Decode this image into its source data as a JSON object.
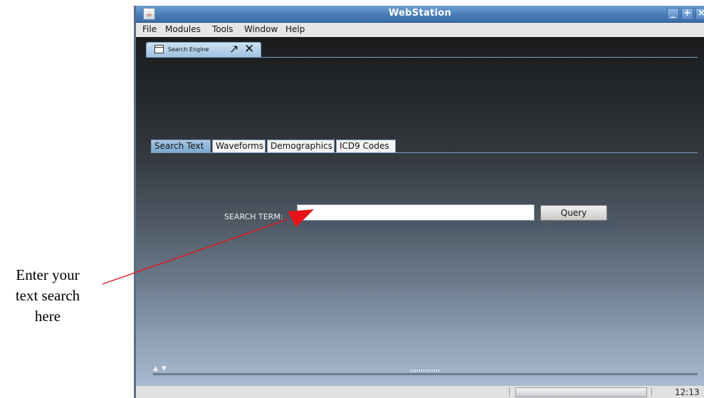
{
  "annotation": {
    "lines": [
      "Enter your",
      "text search",
      "here"
    ],
    "arrow_color": "#e8141a"
  },
  "window": {
    "title": "WebStation",
    "app_icon": "java-cup-icon",
    "buttons": {
      "minimize": "_",
      "maximize": "+",
      "close": "×"
    }
  },
  "menu": {
    "items": [
      "File",
      "Modules",
      "Tools",
      "Window",
      "Help"
    ]
  },
  "document_tab": {
    "label": "Search Engine",
    "icon": "window-frame-icon",
    "pin_glyph": "↗",
    "close_glyph": "✕"
  },
  "tabs": {
    "items": [
      "Search Text",
      "Waveforms",
      "Demographics",
      "ICD9 Codes"
    ],
    "active": "Search Text"
  },
  "search": {
    "label": "SEARCH TERM:",
    "value": "",
    "placeholder": "",
    "button": "Query"
  },
  "splitter": {
    "arrows": "▲ ▼"
  },
  "status": {
    "clock": "12:13"
  },
  "colors": {
    "titlebar": "#4a7db8",
    "tab_active": "#8fb6da",
    "content_top": "#1b1c1e",
    "content_bottom": "#a8bad1"
  }
}
